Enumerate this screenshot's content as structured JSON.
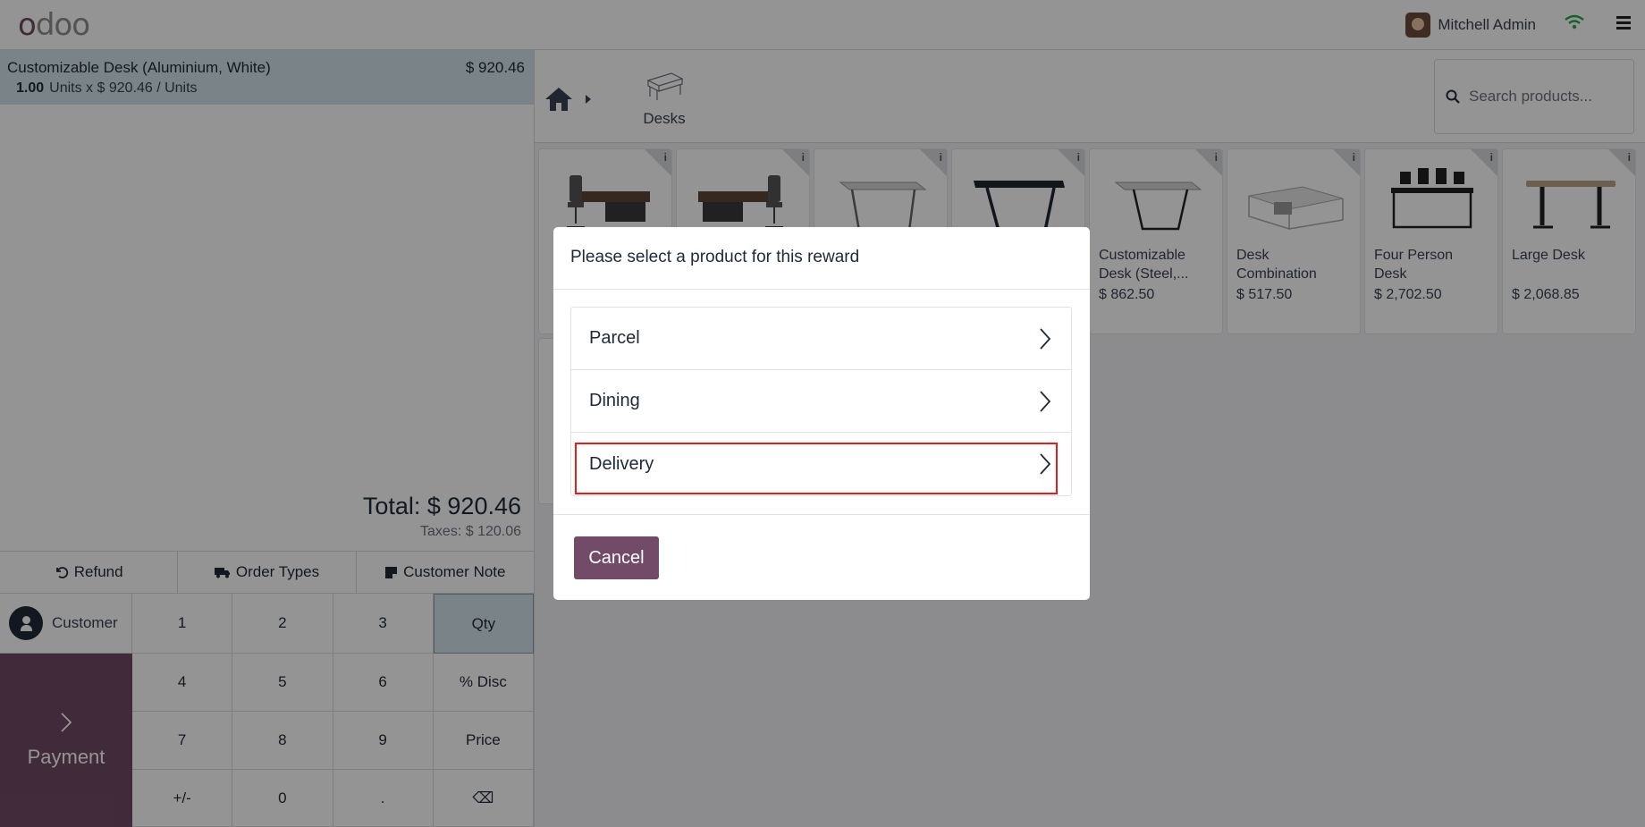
{
  "header": {
    "logo": "odoo",
    "user_name": "Mitchell Admin"
  },
  "order": {
    "line_name": "Customizable Desk (Aluminium, White)",
    "line_price": "$ 920.46",
    "line_qty": "1.00",
    "line_unit_info": "Units x $ 920.46 / Units",
    "total": "Total: $ 920.46",
    "taxes": "Taxes: $ 120.06"
  },
  "actions": {
    "refund": "Refund",
    "order_types": "Order Types",
    "customer_note": "Customer Note"
  },
  "customer_label": "Customer",
  "payment_label": "Payment",
  "numpad": [
    "1",
    "2",
    "3",
    "Qty",
    "4",
    "5",
    "6",
    "% Disc",
    "7",
    "8",
    "9",
    "Price",
    "+/-",
    "0",
    ".",
    "⌫"
  ],
  "category": {
    "label": "Desks"
  },
  "search": {
    "placeholder": "Search products..."
  },
  "products": [
    {
      "name": "",
      "price": ""
    },
    {
      "name": "",
      "price": ""
    },
    {
      "name": "",
      "price": ""
    },
    {
      "name": "",
      "price": ""
    },
    {
      "name": "Customizable Desk (Steel,...",
      "price": "$ 862.50"
    },
    {
      "name": "Desk Combination",
      "price": "$ 517.50"
    },
    {
      "name": "Four Person Desk",
      "price": "$ 2,702.50"
    },
    {
      "name": "Large Desk",
      "price": "$ 2,068.85"
    }
  ],
  "dialog": {
    "title": "Please select a product for this reward",
    "options": [
      "Parcel",
      "Dining",
      "Delivery"
    ],
    "cancel_label": "Cancel"
  },
  "colors": {
    "brand": "#714b67",
    "selected_line": "#d2e3ea",
    "highlight": "#e11d1d"
  }
}
